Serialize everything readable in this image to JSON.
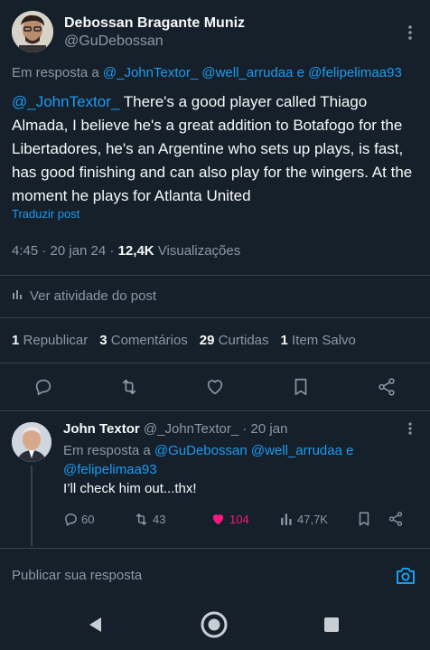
{
  "tweet": {
    "author_name": "Debossan Bragante Muniz",
    "author_handle": "@GuDebossan",
    "reply_prefix": "Em resposta a",
    "reply_to_1": "@_JohnTextor_",
    "reply_to_2": "@well_arrudaa",
    "reply_and": "e",
    "reply_to_3": "@felipelimaa93",
    "mention": "@_JohnTextor_",
    "body": " There's a good player called Thiago Almada, I believe he's a great addition to Botafogo for the Libertadores, he's an Argentine who sets up plays, is fast, has good finishing and can also play for the wingers. At the moment he plays for Atlanta United",
    "translate_label": "Traduzir post",
    "time": "4:45 · 20 jan 24 ·",
    "views_count": "12,4K",
    "views_label": "Visualizações",
    "activity_label": "Ver atividade do post",
    "stats": [
      {
        "count": "1",
        "label": "Republicar"
      },
      {
        "count": "3",
        "label": "Comentários"
      },
      {
        "count": "29",
        "label": "Curtidas"
      },
      {
        "count": "1",
        "label": "Item Salvo"
      }
    ]
  },
  "reply": {
    "author_name": "John Textor",
    "author_handle": "@_JohnTextor_",
    "time": "· 20 jan",
    "reply_prefix": "Em resposta a",
    "reply_to_1": "@GuDebossan",
    "reply_to_2": "@well_arrudaa",
    "reply_and": "e",
    "reply_to_3": "@felipelimaa93",
    "text": "I’ll check him out...thx!",
    "replies": "60",
    "reposts": "43",
    "likes": "104",
    "views": "47,7K"
  },
  "composer": {
    "placeholder": "Publicar sua resposta"
  },
  "colors": {
    "background": "#15202b",
    "accent": "#1d9bf0",
    "like": "#f91880",
    "muted": "#8b98a5",
    "divider": "#38444d"
  },
  "icons": [
    "reply-icon",
    "repost-icon",
    "like-icon",
    "bookmark-icon",
    "share-icon",
    "analytics-icon",
    "camera-icon",
    "more-icon",
    "back-icon",
    "home-icon",
    "recents-icon"
  ]
}
